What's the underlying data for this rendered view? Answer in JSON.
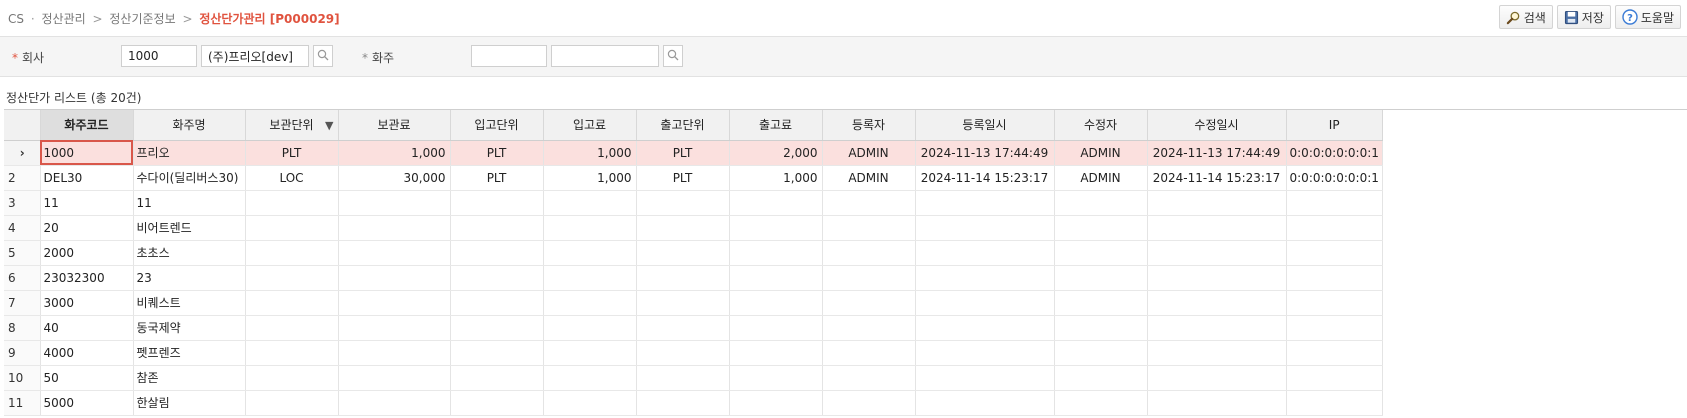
{
  "breadcrumb": {
    "item1": "CS",
    "sep1": "·",
    "item2": "정산관리",
    "sep2": ">",
    "item3": "정산기준정보",
    "sep3": ">",
    "current": "정산단가관리 [P000029]"
  },
  "toolbar": {
    "search_label": "검색",
    "save_label": "저장",
    "help_label": "도움말"
  },
  "search": {
    "company_label": "회사",
    "company_code": "1000",
    "company_name": "(주)프리오[dev]",
    "owner_label": "화주",
    "owner_code": "",
    "owner_name": ""
  },
  "list": {
    "title": "정산단가 리스트 (총 20건)"
  },
  "grid": {
    "columns": [
      "",
      "화주코드",
      "화주명",
      "보관단위",
      "보관료",
      "입고단위",
      "입고료",
      "출고단위",
      "출고료",
      "등록자",
      "등록일시",
      "수정자",
      "수정일시",
      "IP"
    ],
    "rows": [
      {
        "n": "›",
        "code": "1000",
        "name": "프리오",
        "storage_unit": "PLT",
        "storage_fee": "1,000",
        "in_unit": "PLT",
        "in_fee": "1,000",
        "out_unit": "PLT",
        "out_fee": "2,000",
        "reg_user": "ADMIN",
        "reg_date": "2024-11-13 17:44:49",
        "mod_user": "ADMIN",
        "mod_date": "2024-11-13 17:44:49",
        "ip": "0:0:0:0:0:0:0:1"
      },
      {
        "n": "2",
        "code": "DEL30",
        "name": "수다이(딜리버스30)",
        "storage_unit": "LOC",
        "storage_fee": "30,000",
        "in_unit": "PLT",
        "in_fee": "1,000",
        "out_unit": "PLT",
        "out_fee": "1,000",
        "reg_user": "ADMIN",
        "reg_date": "2024-11-14 15:23:17",
        "mod_user": "ADMIN",
        "mod_date": "2024-11-14 15:23:17",
        "ip": "0:0:0:0:0:0:0:1"
      },
      {
        "n": "3",
        "code": "11",
        "name": "11",
        "storage_unit": "",
        "storage_fee": "",
        "in_unit": "",
        "in_fee": "",
        "out_unit": "",
        "out_fee": "",
        "reg_user": "",
        "reg_date": "",
        "mod_user": "",
        "mod_date": "",
        "ip": ""
      },
      {
        "n": "4",
        "code": "20",
        "name": "비어트렌드",
        "storage_unit": "",
        "storage_fee": "",
        "in_unit": "",
        "in_fee": "",
        "out_unit": "",
        "out_fee": "",
        "reg_user": "",
        "reg_date": "",
        "mod_user": "",
        "mod_date": "",
        "ip": ""
      },
      {
        "n": "5",
        "code": "2000",
        "name": "초초스",
        "storage_unit": "",
        "storage_fee": "",
        "in_unit": "",
        "in_fee": "",
        "out_unit": "",
        "out_fee": "",
        "reg_user": "",
        "reg_date": "",
        "mod_user": "",
        "mod_date": "",
        "ip": ""
      },
      {
        "n": "6",
        "code": "23032300",
        "name": "23",
        "storage_unit": "",
        "storage_fee": "",
        "in_unit": "",
        "in_fee": "",
        "out_unit": "",
        "out_fee": "",
        "reg_user": "",
        "reg_date": "",
        "mod_user": "",
        "mod_date": "",
        "ip": ""
      },
      {
        "n": "7",
        "code": "3000",
        "name": "비퀘스트",
        "storage_unit": "",
        "storage_fee": "",
        "in_unit": "",
        "in_fee": "",
        "out_unit": "",
        "out_fee": "",
        "reg_user": "",
        "reg_date": "",
        "mod_user": "",
        "mod_date": "",
        "ip": ""
      },
      {
        "n": "8",
        "code": "40",
        "name": "동국제약",
        "storage_unit": "",
        "storage_fee": "",
        "in_unit": "",
        "in_fee": "",
        "out_unit": "",
        "out_fee": "",
        "reg_user": "",
        "reg_date": "",
        "mod_user": "",
        "mod_date": "",
        "ip": ""
      },
      {
        "n": "9",
        "code": "4000",
        "name": "펫프렌즈",
        "storage_unit": "",
        "storage_fee": "",
        "in_unit": "",
        "in_fee": "",
        "out_unit": "",
        "out_fee": "",
        "reg_user": "",
        "reg_date": "",
        "mod_user": "",
        "mod_date": "",
        "ip": ""
      },
      {
        "n": "10",
        "code": "50",
        "name": "참존",
        "storage_unit": "",
        "storage_fee": "",
        "in_unit": "",
        "in_fee": "",
        "out_unit": "",
        "out_fee": "",
        "reg_user": "",
        "reg_date": "",
        "mod_user": "",
        "mod_date": "",
        "ip": ""
      },
      {
        "n": "11",
        "code": "5000",
        "name": "한살림",
        "storage_unit": "",
        "storage_fee": "",
        "in_unit": "",
        "in_fee": "",
        "out_unit": "",
        "out_fee": "",
        "reg_user": "",
        "reg_date": "",
        "mod_user": "",
        "mod_date": "",
        "ip": ""
      }
    ]
  },
  "colors": {
    "accent": "#e0533f",
    "selected_row": "#fbe0de",
    "focus_border": "#d9574a"
  }
}
